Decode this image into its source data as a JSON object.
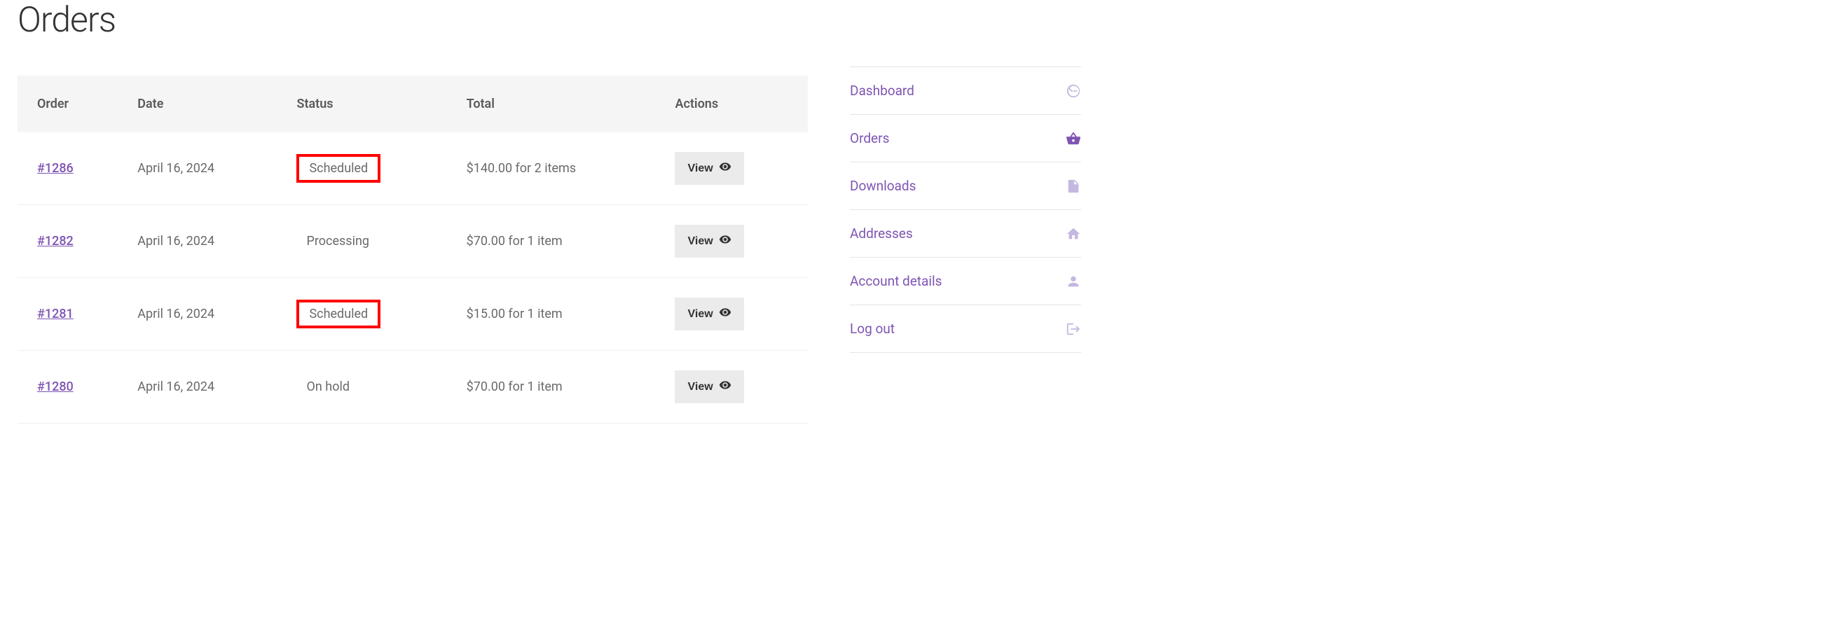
{
  "page_title": "Orders",
  "table": {
    "headers": {
      "order": "Order",
      "date": "Date",
      "status": "Status",
      "total": "Total",
      "actions": "Actions"
    },
    "rows": [
      {
        "order_id": "#1286",
        "date": "April 16, 2024",
        "status": "Scheduled",
        "highlighted": true,
        "total": "$140.00 for 2 items",
        "action_label": "View"
      },
      {
        "order_id": "#1282",
        "date": "April 16, 2024",
        "status": "Processing",
        "highlighted": false,
        "total": "$70.00 for 1 item",
        "action_label": "View"
      },
      {
        "order_id": "#1281",
        "date": "April 16, 2024",
        "status": "Scheduled",
        "highlighted": true,
        "total": "$15.00 for 1 item",
        "action_label": "View"
      },
      {
        "order_id": "#1280",
        "date": "April 16, 2024",
        "status": "On hold",
        "highlighted": false,
        "total": "$70.00 for 1 item",
        "action_label": "View"
      }
    ]
  },
  "sidebar": {
    "items": [
      {
        "label": "Dashboard",
        "icon": "dashboard-icon",
        "active": false
      },
      {
        "label": "Orders",
        "icon": "basket-icon",
        "active": true
      },
      {
        "label": "Downloads",
        "icon": "file-icon",
        "active": false
      },
      {
        "label": "Addresses",
        "icon": "home-icon",
        "active": false
      },
      {
        "label": "Account details",
        "icon": "user-icon",
        "active": false
      },
      {
        "label": "Log out",
        "icon": "logout-icon",
        "active": false
      }
    ]
  }
}
